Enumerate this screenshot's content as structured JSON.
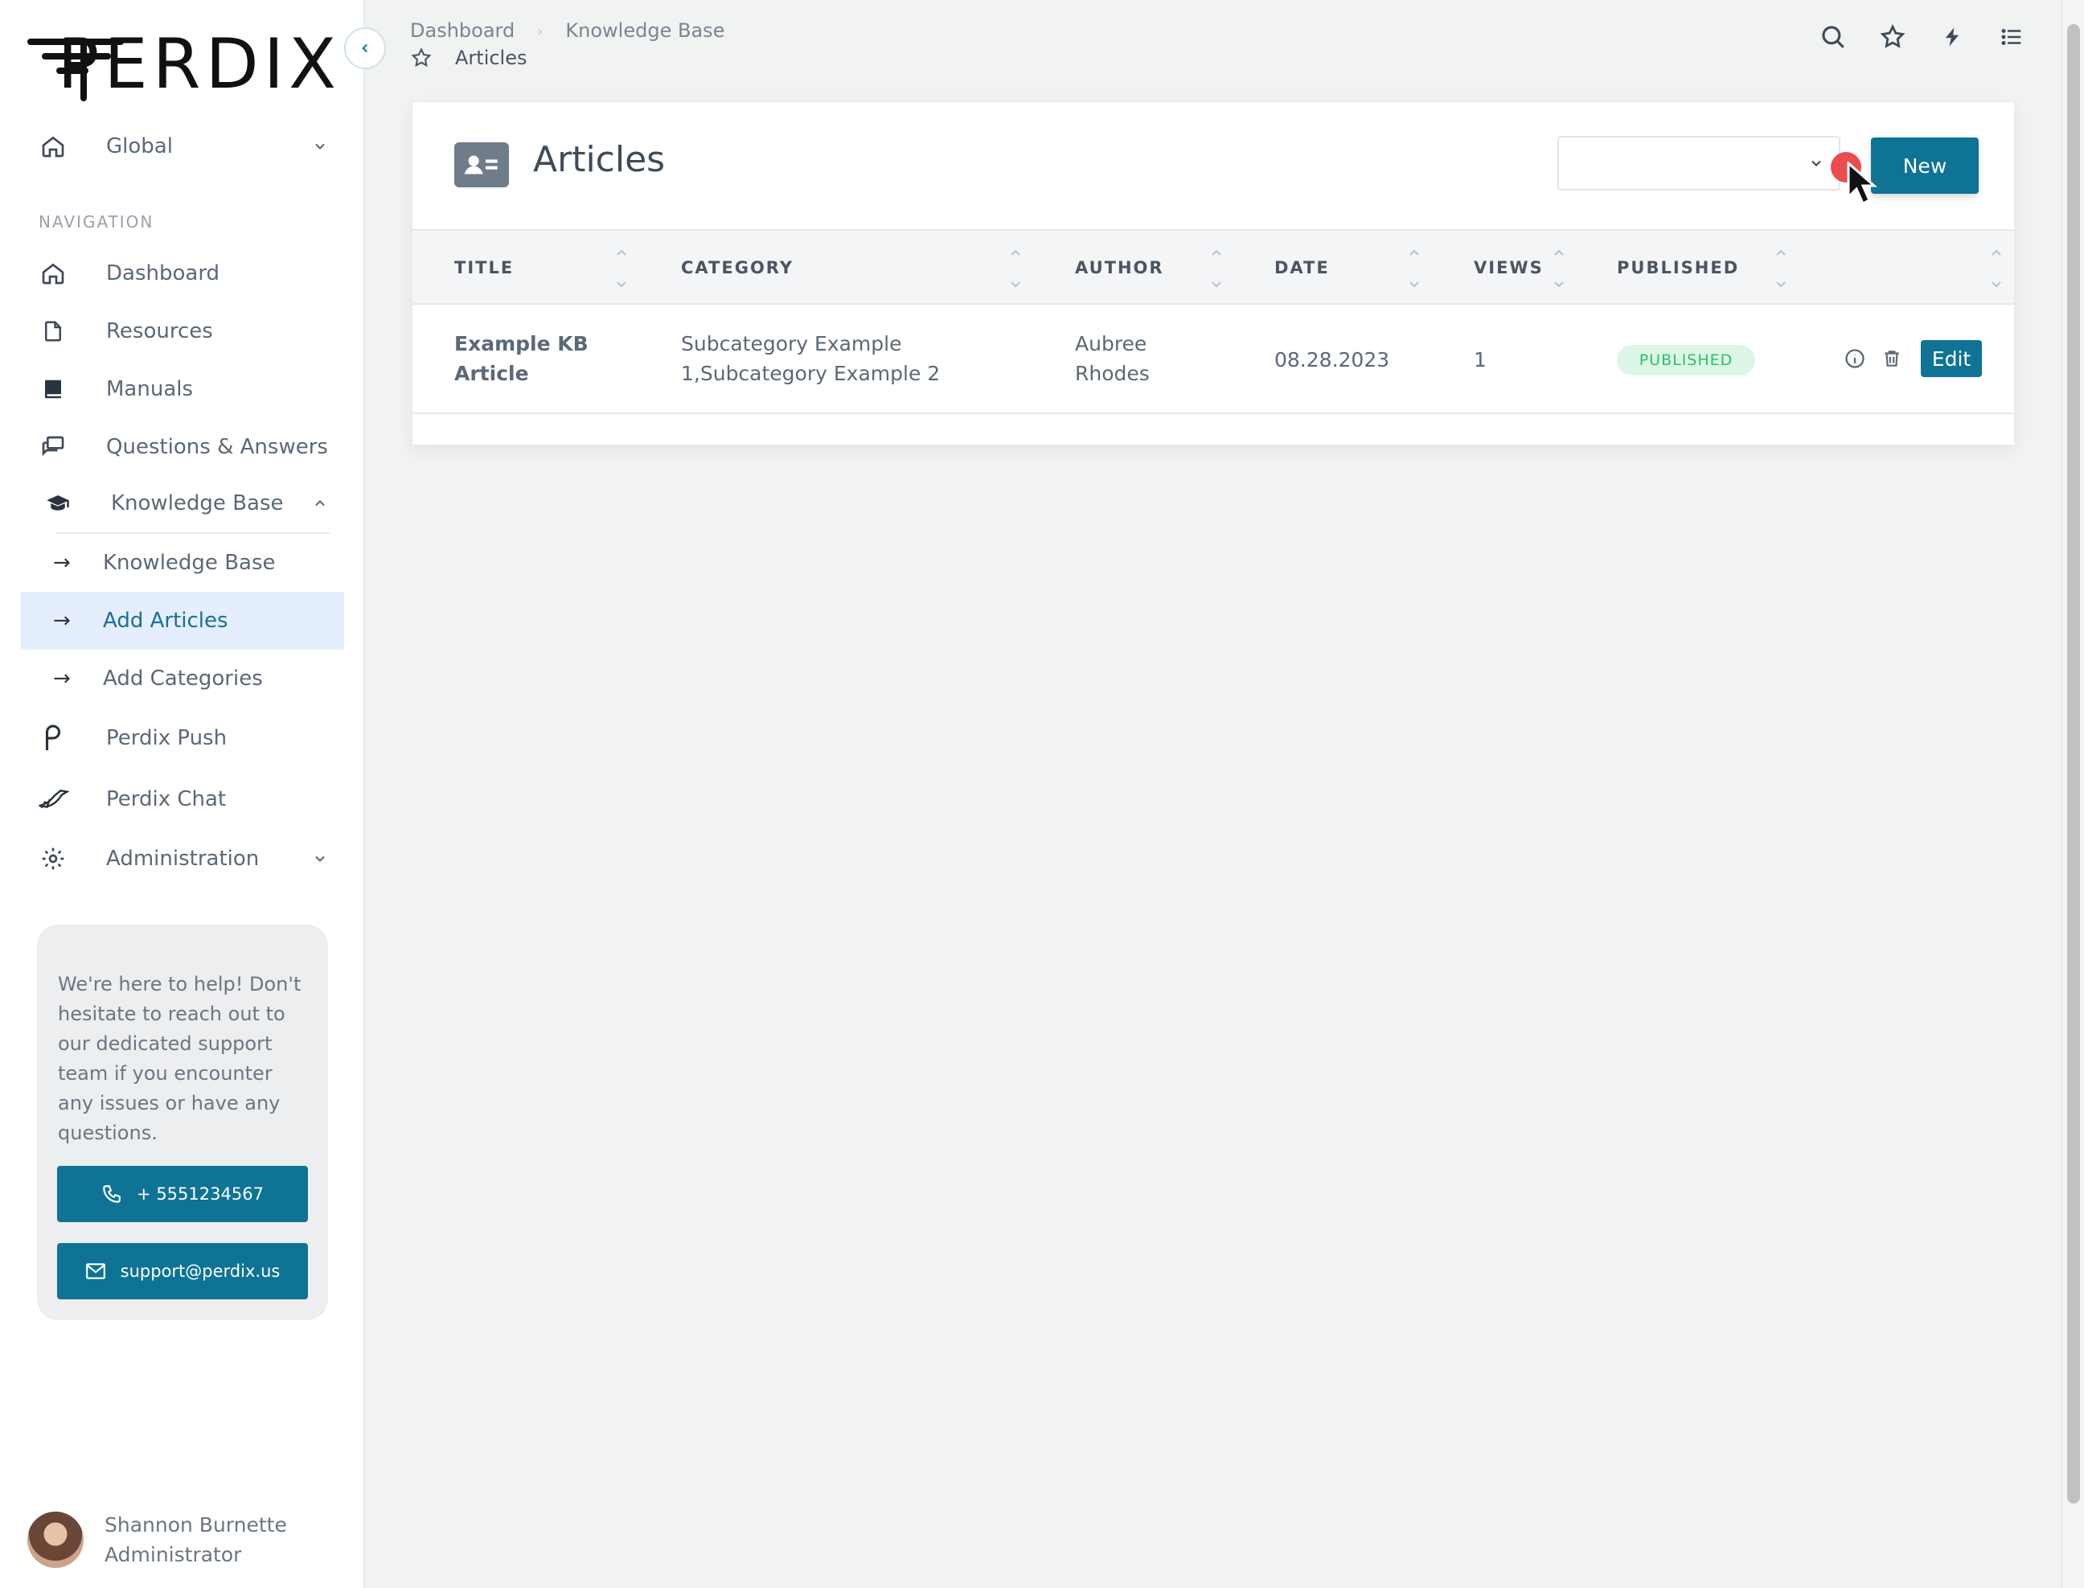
{
  "brand": {
    "logo_text": "PERDIX"
  },
  "sidebar": {
    "global_label": "Global",
    "section_label": "NAVIGATION",
    "items": [
      {
        "label": "Dashboard"
      },
      {
        "label": "Resources"
      },
      {
        "label": "Manuals"
      },
      {
        "label": "Questions & Answers"
      },
      {
        "label": "Knowledge Base"
      }
    ],
    "sub_items": [
      {
        "label": "Knowledge Base"
      },
      {
        "label": "Add Articles"
      },
      {
        "label": "Add Categories"
      }
    ],
    "bottom_items": [
      {
        "label": "Perdix Push"
      },
      {
        "label": "Perdix Chat"
      },
      {
        "label": "Administration"
      }
    ],
    "help": {
      "text": "We're here to help! Don't hesitate to reach out to our dedicated support team if you encounter any issues or have any questions.",
      "phone": "+ 5551234567",
      "email": "support@perdix.us"
    },
    "user": {
      "name": "Shannon Burnette",
      "role": "Administrator"
    }
  },
  "breadcrumb": {
    "items": [
      "Dashboard",
      "Knowledge Base"
    ],
    "current": "Articles"
  },
  "card": {
    "title": "Articles",
    "filter_value": "",
    "new_label": "New"
  },
  "table": {
    "headers": [
      "TITLE",
      "CATEGORY",
      "AUTHOR",
      "DATE",
      "VIEWS",
      "PUBLISHED"
    ],
    "rows": [
      {
        "title_line1": "Example KB",
        "title_line2": "Article",
        "category_line1": "Subcategory Example",
        "category_line2": "1,Subcategory Example 2",
        "author_line1": "Aubree",
        "author_line2": "Rhodes",
        "date": "08.28.2023",
        "views": "1",
        "status": "PUBLISHED",
        "edit_label": "Edit"
      }
    ]
  },
  "colors": {
    "primary": "#0e7394",
    "active_bg": "#e4eefc",
    "badge_bg": "#dcf7e7",
    "badge_text": "#2bbf6b"
  }
}
